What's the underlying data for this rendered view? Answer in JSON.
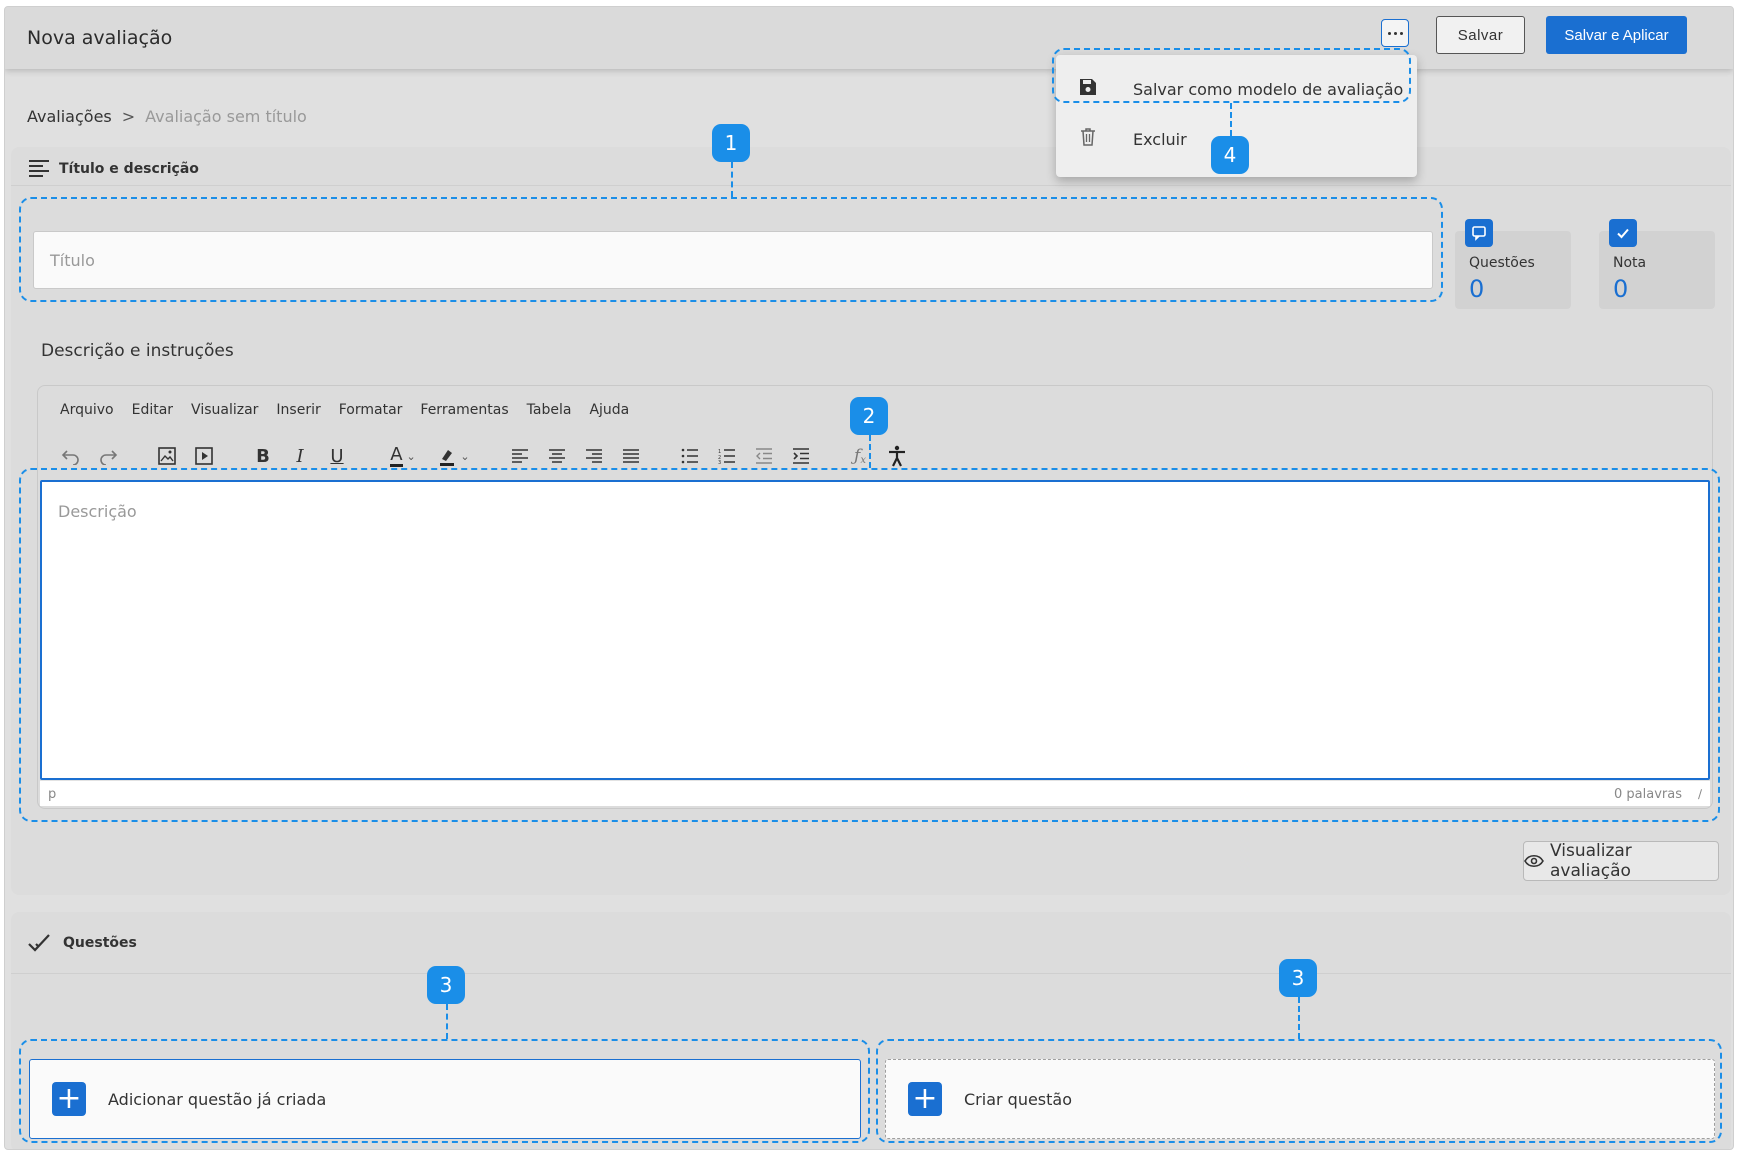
{
  "app": {
    "title": "Nova avaliação"
  },
  "header": {
    "save_label": "Salvar",
    "apply_label": "Salvar e Aplicar"
  },
  "menu": {
    "items": [
      {
        "label": "Salvar como modelo de avaliação",
        "icon": "floppy-disk-icon"
      },
      {
        "label": "Excluir",
        "icon": "trash-icon"
      }
    ]
  },
  "breadcrumb": {
    "parent": "Avaliações",
    "separator": ">",
    "current": "Avaliação sem título"
  },
  "title_section": {
    "heading": "Título e descrição",
    "title_placeholder": "Título"
  },
  "stats": {
    "questions": {
      "label": "Questões",
      "value": "0"
    },
    "grade": {
      "label": "Nota",
      "value": "0"
    }
  },
  "editor": {
    "label": "Descrição e instruções",
    "menubar": [
      "Arquivo",
      "Editar",
      "Visualizar",
      "Inserir",
      "Formatar",
      "Ferramentas",
      "Tabela",
      "Ajuda"
    ],
    "placeholder": "Descrição",
    "path": "p",
    "word_count": "0 palavras"
  },
  "preview_label": "Visualizar avaliação",
  "questions_section": {
    "heading": "Questões",
    "add_existing_label": "Adicionar questão já criada",
    "create_label": "Criar questão"
  },
  "callouts": {
    "c1": "1",
    "c2": "2",
    "c3a": "3",
    "c3b": "3",
    "c4": "4"
  },
  "colors": {
    "accent": "#1a6fd1",
    "callout": "#1a8ee8",
    "background": "#e0e0e0"
  }
}
